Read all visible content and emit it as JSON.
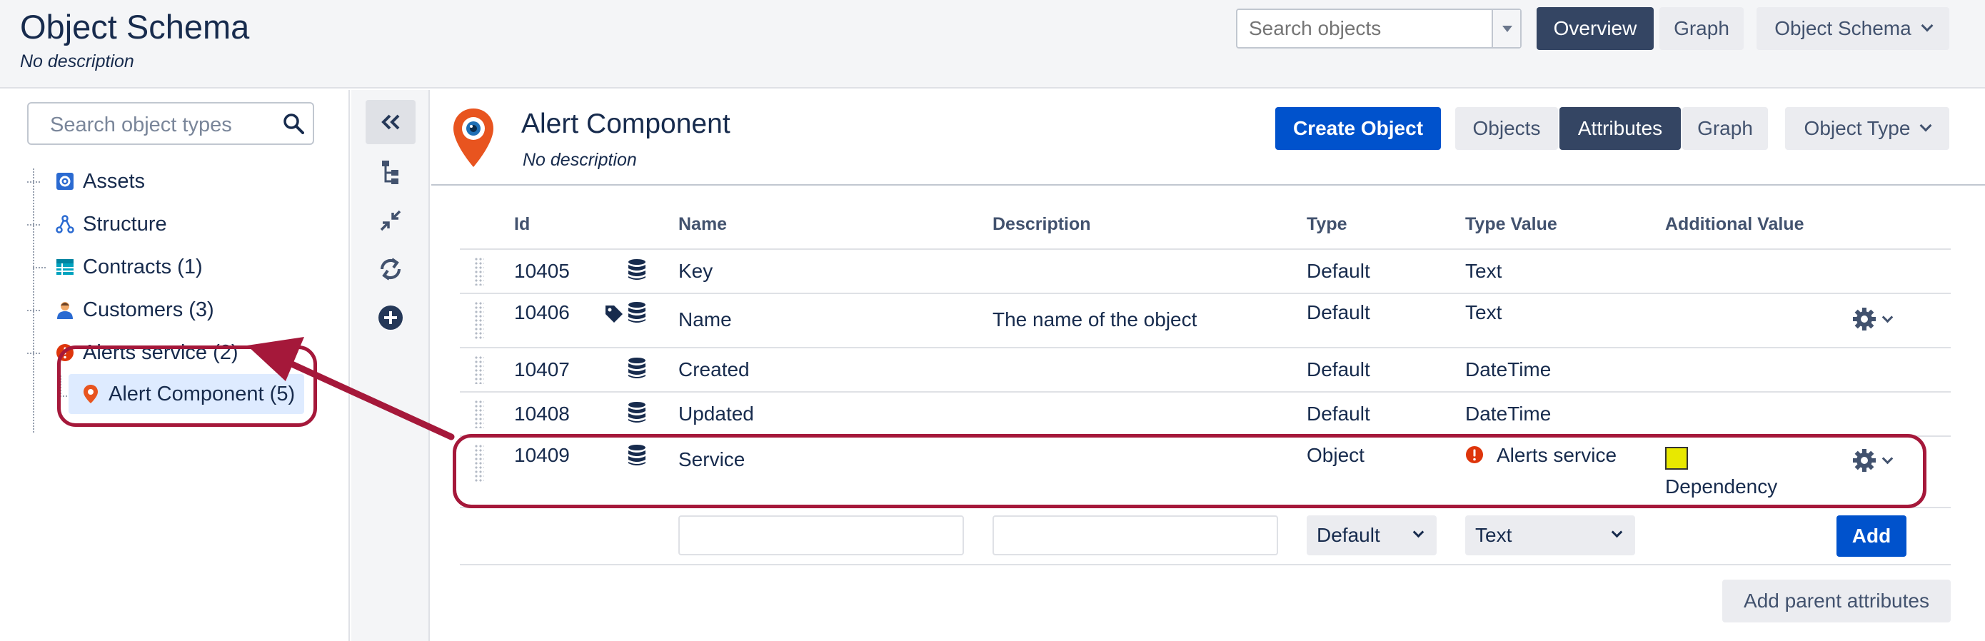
{
  "header": {
    "title": "Object Schema",
    "description": "No description",
    "search_placeholder": "Search objects",
    "overview_label": "Overview",
    "graph_label": "Graph",
    "schema_menu_label": "Object Schema"
  },
  "sidebar": {
    "search_placeholder": "Search object types",
    "items": [
      {
        "label": "Assets",
        "icon": "gear-square-icon"
      },
      {
        "label": "Structure",
        "icon": "hierarchy-icon"
      },
      {
        "label": "Contracts (1)",
        "icon": "table-icon"
      },
      {
        "label": "Customers (3)",
        "icon": "person-icon"
      },
      {
        "label": "Alerts service (2)",
        "icon": "alert-icon"
      },
      {
        "label": "Alert Component (5)",
        "icon": "map-pin-icon"
      }
    ]
  },
  "object_type": {
    "title": "Alert Component",
    "description": "No description",
    "create_label": "Create Object",
    "tabs": [
      "Objects",
      "Attributes",
      "Graph"
    ],
    "active_tab": "Attributes",
    "type_menu_label": "Object Type"
  },
  "table": {
    "headers": {
      "id": "Id",
      "name": "Name",
      "description": "Description",
      "type": "Type",
      "type_value": "Type Value",
      "additional_value": "Additional Value"
    },
    "rows": [
      {
        "id": "10405",
        "name": "Key",
        "description": "",
        "type": "Default",
        "type_value": "Text",
        "additional": "",
        "label_icon": false,
        "menu": false
      },
      {
        "id": "10406",
        "name": "Name",
        "description": "The name of the object",
        "type": "Default",
        "type_value": "Text",
        "additional": "",
        "label_icon": true,
        "menu": true
      },
      {
        "id": "10407",
        "name": "Created",
        "description": "",
        "type": "Default",
        "type_value": "DateTime",
        "additional": "",
        "label_icon": false,
        "menu": false
      },
      {
        "id": "10408",
        "name": "Updated",
        "description": "",
        "type": "Default",
        "type_value": "DateTime",
        "additional": "",
        "label_icon": false,
        "menu": false
      },
      {
        "id": "10409",
        "name": "Service",
        "description": "",
        "type": "Object",
        "type_value": "Alerts service",
        "additional": "Dependency",
        "label_icon": false,
        "menu": true
      }
    ],
    "new_row": {
      "type_select": "Default",
      "type_value_select": "Text",
      "add_label": "Add"
    },
    "add_parent_label": "Add parent attributes"
  },
  "colors": {
    "primary": "#0052cc",
    "dark_tab": "#344563",
    "annotation": "#a5183a",
    "alert_red": "#de350b",
    "swatch": "#e8e800"
  }
}
